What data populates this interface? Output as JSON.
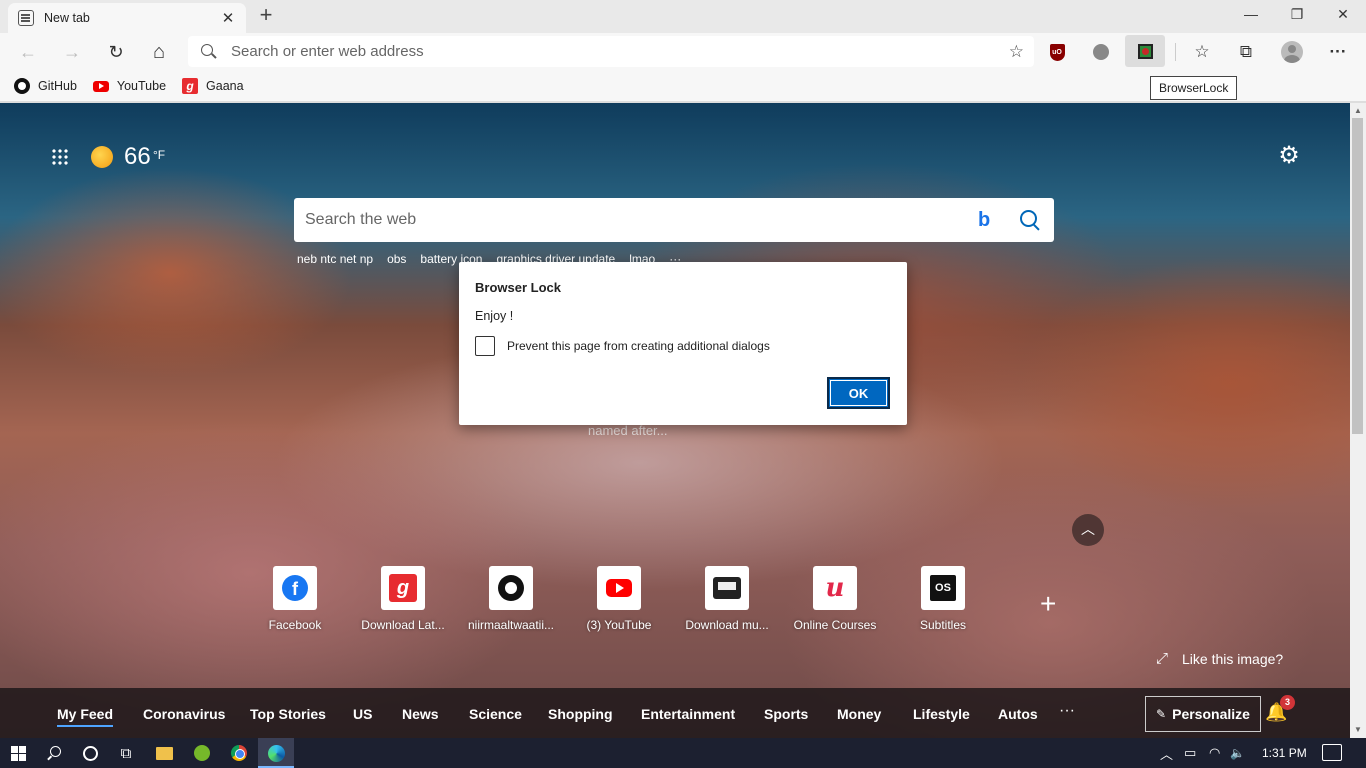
{
  "tab": {
    "title": "New tab",
    "close": "✕"
  },
  "window": {
    "minimize": "—",
    "restore": "❐",
    "close": "✕"
  },
  "nav": {
    "back": "←",
    "forward": "→",
    "refresh": "↻",
    "home": "⌂"
  },
  "address": {
    "placeholder": "Search or enter web address",
    "add_favorite": "☆"
  },
  "extensions": {
    "ublock_text": "uO"
  },
  "toolbar_icons": {
    "favorites": "☆",
    "collections": "⧉",
    "more": "···"
  },
  "tooltip": "BrowserLock",
  "favorites": [
    {
      "label": "GitHub"
    },
    {
      "label": "YouTube"
    },
    {
      "label": "Gaana",
      "icon_text": "g"
    }
  ],
  "weather": {
    "temp": "66",
    "unit": "°F"
  },
  "bing": {
    "placeholder": "Search the web",
    "logo": "b"
  },
  "trending": [
    "neb ntc net np",
    "obs",
    "battery icon",
    "graphics driver update",
    "lmao",
    "···"
  ],
  "hero_caption": "named after...",
  "collapse": "︿",
  "quick_links": [
    {
      "label": "Facebook",
      "icon_text": "f"
    },
    {
      "label": "Download Lat...",
      "icon_text": "g"
    },
    {
      "label": "niirmaaltwaatii..."
    },
    {
      "label": "(3) YouTube"
    },
    {
      "label": "Download mu..."
    },
    {
      "label": "Online Courses",
      "icon_text": "u"
    },
    {
      "label": "Subtitles",
      "icon_text": "OS"
    }
  ],
  "add_site": "+",
  "like_image": {
    "label": "Like this image?",
    "icon": "⤢"
  },
  "feed": {
    "tabs": [
      "My Feed",
      "Coronavirus",
      "Top Stories",
      "US",
      "News",
      "Science",
      "Shopping",
      "Entertainment",
      "Sports",
      "Money",
      "Lifestyle",
      "Autos"
    ],
    "more": "···",
    "personalize": "Personalize",
    "pencil": "✎",
    "bell": "🔔",
    "notification_count": "3"
  },
  "dialog": {
    "title": "Browser Lock",
    "message": "Enjoy !",
    "checkbox_label": "Prevent this page from creating additional dialogs",
    "ok": "OK"
  },
  "taskbar": {
    "taskview": "⧉",
    "tray": {
      "chevron": "︿",
      "battery": "▭",
      "wifi": "◠",
      "volume": "🔈"
    },
    "time": "1:31 PM"
  },
  "scrollbar": {
    "up": "▲",
    "down": "▼"
  }
}
